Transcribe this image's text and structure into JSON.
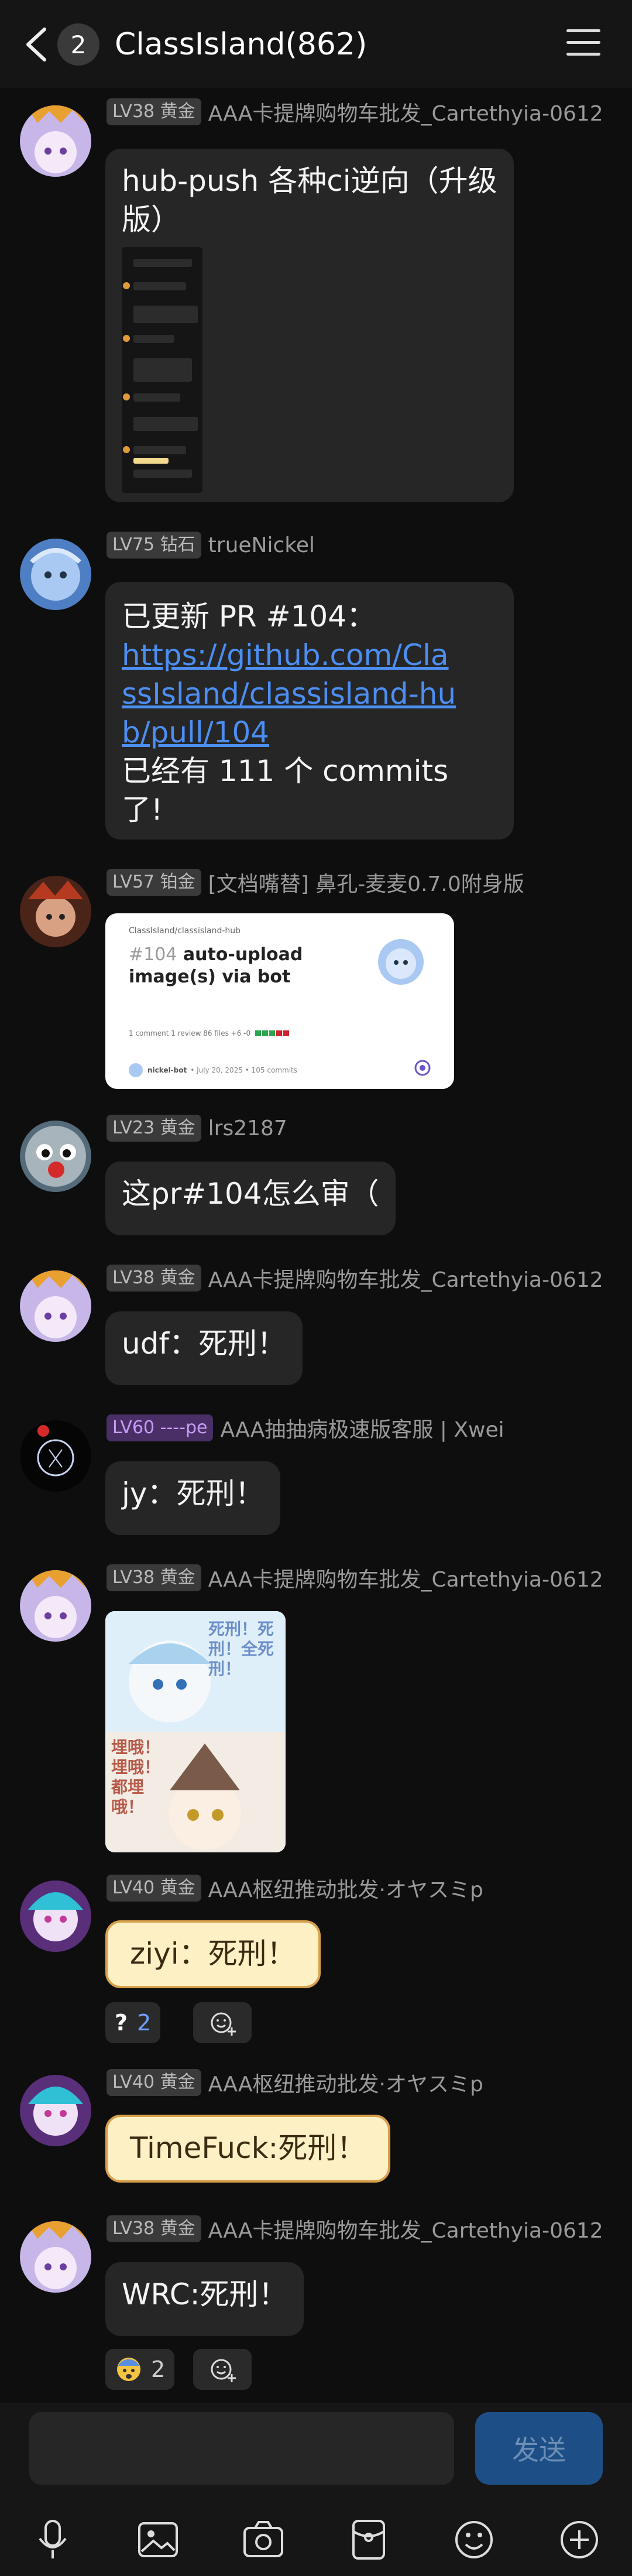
{
  "header": {
    "unread_count": "2",
    "title": "ClassIsland(862)"
  },
  "messages": [
    {
      "level": "LV38 黄金",
      "nickname": "AAA卡提牌购物车批发_Cartethyia-0612",
      "text": "hub-push 各种ci逆向（升级版）"
    },
    {
      "level": "LV75 钻石",
      "nickname": "trueNickel",
      "line1": "已更新 PR #104：",
      "link": "https://github.com/ClassIsland/classisland-hub/pull/104",
      "line3": "已经有 111 个 commits 了!"
    },
    {
      "level": "LV57 铂金",
      "nickname": "[文档嘴替] 鼻孔-麦麦0.7.0附身版",
      "card": {
        "repo": "ClassIsland/classisland-hub",
        "pr": "#104",
        "title": "auto-upload image(s) via bot",
        "stats": "1 comment   1 review   86 files   +6 -0",
        "author": "nickel-bot",
        "date": "• July 20, 2025 • 105 commits"
      }
    },
    {
      "level": "LV23 黄金",
      "nickname": "lrs2187",
      "text": "这pr#104怎么审（"
    },
    {
      "level": "LV38 黄金",
      "nickname": "AAA卡提牌购物车批发_Cartethyia-0612",
      "text": "udf：死刑！"
    },
    {
      "level": "LV60 ----pe",
      "nickname": "AAA抽抽病极速版客服 | Xwei",
      "text": "jy：死刑！"
    },
    {
      "level": "LV38 黄金",
      "nickname": "AAA卡提牌购物车批发_Cartethyia-0612",
      "sticker_top": "死刑！死刑！全死刑！",
      "sticker_bottom": "埋哦！埋哦！都埋哦！"
    },
    {
      "level": "LV40 黄金",
      "nickname": "AAA枢纽推动批发·オヤスミp",
      "text": "ziyi：死刑！",
      "reaction_count": "2"
    },
    {
      "level": "LV40 黄金",
      "nickname": "AAA枢纽推动批发·オヤスミp",
      "text": "TimeFuck:死刑！"
    },
    {
      "level": "LV38 黄金",
      "nickname": "AAA卡提牌购物车批发_Cartethyia-0612",
      "text": "WRC:死刑！",
      "reaction_count": "2"
    }
  ],
  "input": {
    "placeholder": "",
    "send_label": "发送"
  },
  "toolbar": [
    "mic-icon",
    "image-icon",
    "camera-icon",
    "red-packet-icon",
    "emoji-icon",
    "plus-icon"
  ],
  "colors": {
    "background": "#0e0e0e",
    "bubble": "#262626",
    "link": "#4c8ef2",
    "send": "#1d4f86"
  }
}
